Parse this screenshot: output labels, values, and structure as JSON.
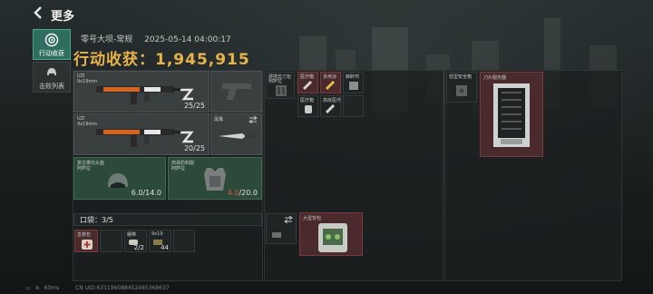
{
  "header": {
    "title": "更多"
  },
  "tabs": [
    {
      "label": "行动收获",
      "icon": "target-icon",
      "active": true
    },
    {
      "label": "击败列表",
      "icon": "helmet-icon",
      "active": false
    }
  ],
  "summary": {
    "map": "零号大坝-常规",
    "datetime": "2025-05-14 04:00:17",
    "harvest_label": "行动收获：",
    "harvest_value": "1,945,915"
  },
  "weapons": [
    {
      "name": "UZI",
      "caliber": "9x19mm",
      "ammo": "25/25",
      "icon": "smg-icon"
    },
    {
      "name": "UZI",
      "caliber": "9x19mm",
      "ammo": "20/25",
      "icon": "smg-icon"
    }
  ],
  "pistol_slot": {
    "icon": "pistol-icon"
  },
  "melee": {
    "name": "黑鹰",
    "icon": "knife-icon"
  },
  "helmet": {
    "name": "复古摩托头盔",
    "type": "阿萨拉",
    "durability": "6.0/14.0"
  },
  "armor": {
    "name": "简易防刺服",
    "type": "阿萨拉",
    "durability_current": "4.0",
    "durability_max": "/20.0"
  },
  "pouch": {
    "label": "口袋：",
    "count": "3/5"
  },
  "pouch_items": [
    {
      "name": "急救包",
      "qty": ""
    },
    {
      "name": "绷带",
      "qty": "2/2"
    },
    {
      "name": "9x19",
      "qty": "44"
    }
  ],
  "chest_rig": {
    "name": "便携剪刀包",
    "sub": "阿萨拉",
    "items": [
      {
        "name": "医疗箱"
      },
      {
        "name": "多用涂"
      },
      {
        "name": "麻醉剂"
      },
      {
        "name": "医疗箱"
      },
      {
        "name": "高级医疗"
      }
    ]
  },
  "backpack": {
    "name": "大型背包"
  },
  "safe_box": {
    "name": "轻型安全箱"
  },
  "server": {
    "name": "刀片服务器"
  },
  "status_bar": {
    "ping": "60ms",
    "uid": "CN UID:631196088452485368637"
  },
  "colors": {
    "accent": "#2f6d5f",
    "gold": "#e8b44a",
    "danger": "#e05050",
    "value_red": "#7a3a3c",
    "value_green": "#3f6a52"
  }
}
